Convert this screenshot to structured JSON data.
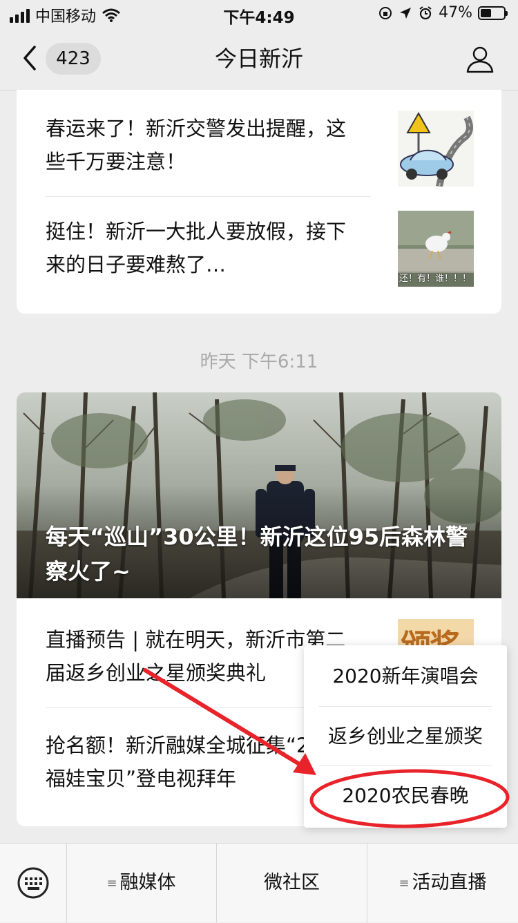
{
  "status_bar": {
    "carrier": "中国移动",
    "time": "下午4:49",
    "battery": "47%",
    "battery_level": 0.47
  },
  "nav": {
    "back_count": "423",
    "title": "今日新沂",
    "icons": [
      "chevron-left-icon",
      "profile-icon"
    ]
  },
  "articles_top": [
    {
      "title": "春运来了！新沂交警发出提醒，这些千万要注意！"
    },
    {
      "title": "挺住！新沂一大批人要放假，接下来的日子要难熬了…",
      "thumb_caption": "还！有！谁！！！"
    }
  ],
  "timestamp": "昨天 下午6:11",
  "featured": {
    "title": "每天“巡山”30公里！新沂这位95后森林警察火了~"
  },
  "articles_bottom": [
    {
      "title": "直播预告 | 就在明天，新沂市第二届返乡创业之星颁奖典礼",
      "thumb_text": "颁奖"
    },
    {
      "title": "抢名额！新沂融媒全城征集“2020福娃宝贝”登电视拜年"
    }
  ],
  "popup_menu": {
    "items": [
      "2020新年演唱会",
      "返乡创业之星颁奖",
      "2020农民春晚"
    ]
  },
  "bottom_menu": {
    "keyboard_icon": "keyboard-icon",
    "items": [
      "融媒体",
      "微社区",
      "活动直播"
    ]
  },
  "colors": {
    "annotation_red": "#e8232a",
    "background": "#ededed"
  }
}
